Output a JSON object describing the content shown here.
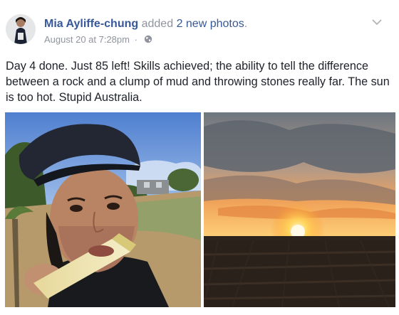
{
  "post": {
    "author": "Mia Ayliffe-chung",
    "action": "added",
    "photo_count_text": "2 new photos",
    "action_suffix": ".",
    "timestamp": "August 20 at 7:28pm",
    "separator": "·",
    "privacy_icon": "globe-icon",
    "options_icon": "chevron-down-icon",
    "text": "Day 4 done. Just 85 left! Skills achieved; the ability to tell the difference between a rock and a clump of mud and throwing stones really far. The sun is too hot. Stupid Australia.",
    "photos": [
      {
        "subject": "selfie-with-sugarcane"
      },
      {
        "subject": "sunset-over-ploughed-field"
      }
    ]
  },
  "colors": {
    "link": "#365899",
    "secondary_text": "#90949c",
    "body_text": "#1d2129"
  }
}
